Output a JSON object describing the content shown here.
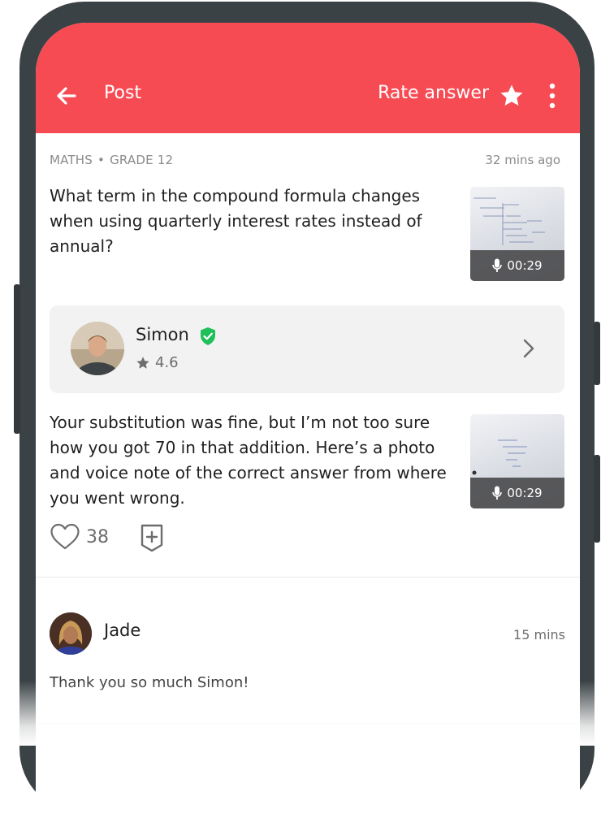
{
  "app_bar": {
    "title": "Post",
    "rate_label": "Rate answer",
    "icons": [
      "arrow-left-icon",
      "star-icon",
      "more-vertical-icon"
    ]
  },
  "post": {
    "subject": "MATHS",
    "grade": "GRADE 12",
    "time_ago": "32 mins ago",
    "question": "What term in the compound formula changes when using quarterly interest rates instead of annual?",
    "media_duration": "00:29"
  },
  "author": {
    "name": "Simon",
    "rating": "4.6",
    "verified": true
  },
  "answer": {
    "text": "Your substitution was fine, but I’m not too sure how you got 70 in that addition. Here’s a photo and voice note of the correct answer from where you went wrong.",
    "media_duration": "00:29",
    "likes": "38"
  },
  "comment": {
    "name": "Jade",
    "time": "15 mins",
    "text": "Thank you so much Simon!"
  },
  "colors": {
    "accent": "#f74b54",
    "verified": "#1fbf5a",
    "muted_text": "#8a8a8a",
    "card_bg": "#f2f2f2"
  }
}
